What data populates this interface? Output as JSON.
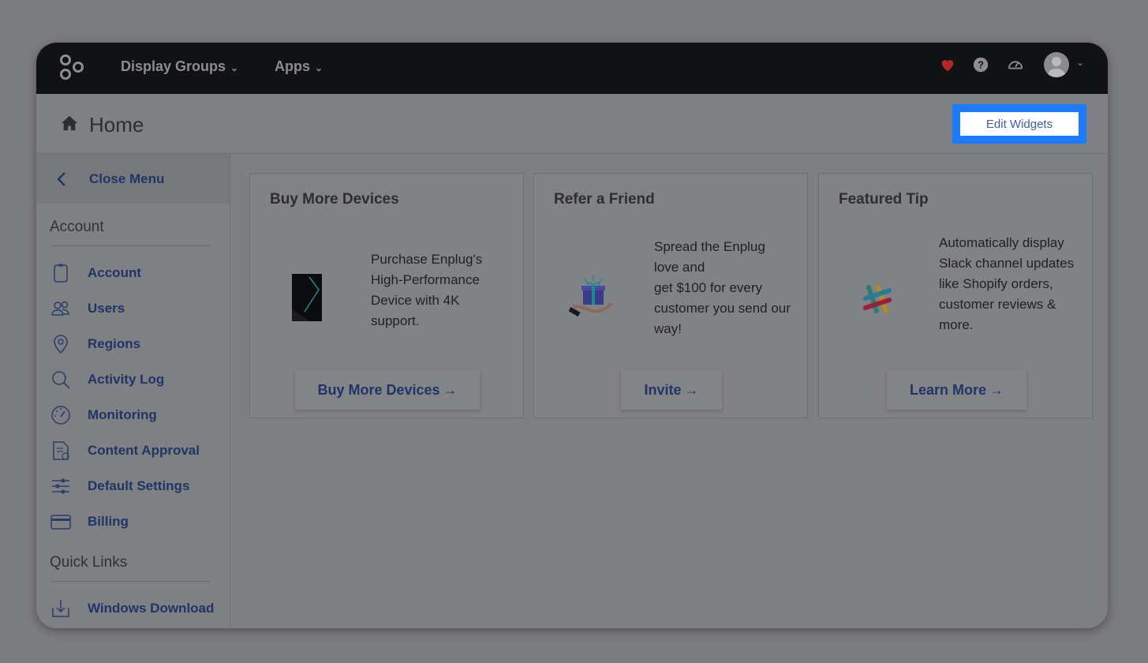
{
  "nav": {
    "items": [
      {
        "label": "Display Groups"
      },
      {
        "label": "Apps"
      }
    ]
  },
  "header": {
    "title": "Home",
    "edit_widgets_label": "Edit Widgets"
  },
  "sidebar": {
    "close_menu_label": "Close Menu",
    "account_section": "Account",
    "account_items": [
      {
        "label": "Account",
        "icon": "clipboard-icon"
      },
      {
        "label": "Users",
        "icon": "users-icon"
      },
      {
        "label": "Regions",
        "icon": "map-pin-icon"
      },
      {
        "label": "Activity Log",
        "icon": "search-icon"
      },
      {
        "label": "Monitoring",
        "icon": "gauge-icon"
      },
      {
        "label": "Content Approval",
        "icon": "document-check-icon"
      },
      {
        "label": "Default Settings",
        "icon": "sliders-icon"
      },
      {
        "label": "Billing",
        "icon": "credit-card-icon"
      }
    ],
    "quick_links_section": "Quick Links",
    "quick_links": [
      {
        "label": "Windows Download",
        "icon": "download-icon"
      }
    ]
  },
  "cards": [
    {
      "title": "Buy More Devices",
      "text": "Purchase Enplug's High-Performance Device with 4K support.",
      "button": "Buy More Devices",
      "arrow": "→"
    },
    {
      "title": "Refer a Friend",
      "text_lines": [
        "Spread the Enplug love and",
        "get $100 for every customer you send our way!"
      ],
      "button": "Invite",
      "arrow": "→"
    },
    {
      "title": "Featured Tip",
      "text": "Automatically display Slack channel updates like Shopify orders, customer reviews & more.",
      "button": "Learn More",
      "arrow": "→"
    }
  ],
  "colors": {
    "accent": "#1d7bff",
    "link": "#1f3566",
    "nav_bg": "#111214",
    "heart": "#b3262a"
  }
}
